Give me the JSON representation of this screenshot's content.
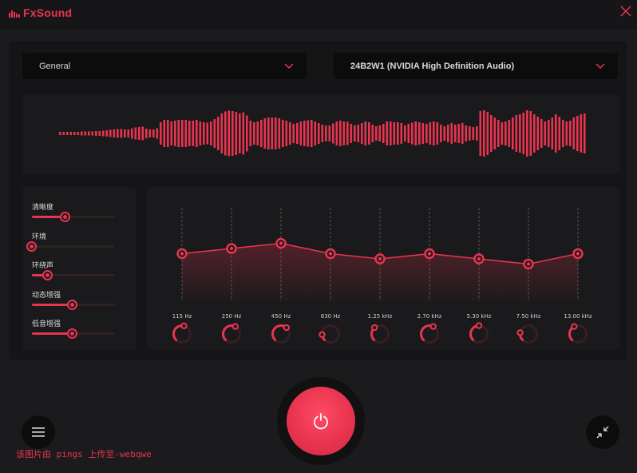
{
  "app": {
    "title": "FxSound"
  },
  "colors": {
    "accent": "#e8344f",
    "background": "#1b1b1d",
    "panel": "#151517",
    "card": "#1a1a1c"
  },
  "presets": {
    "selected": "General"
  },
  "output_device": {
    "selected": "24B2W1 (NVIDIA High Definition Audio)"
  },
  "effects": [
    {
      "label": "清晰度",
      "value": 0.4
    },
    {
      "label": "环境",
      "value": 0.0
    },
    {
      "label": "环绕声",
      "value": 0.19
    },
    {
      "label": "动态增强",
      "value": 0.49
    },
    {
      "label": "低音增强",
      "value": 0.49
    }
  ],
  "equalizer": {
    "bands": [
      {
        "freq": "115 Hz",
        "gain": 0.45,
        "dial": 0.55
      },
      {
        "freq": "250 Hz",
        "gain": 0.5,
        "dial": 0.6
      },
      {
        "freq": "450 Hz",
        "gain": 0.55,
        "dial": 0.65
      },
      {
        "freq": "630 Hz",
        "gain": 0.45,
        "dial": 0.15
      },
      {
        "freq": "1.25 kHz",
        "gain": 0.4,
        "dial": 0.35
      },
      {
        "freq": "2.70 kHz",
        "gain": 0.45,
        "dial": 0.6
      },
      {
        "freq": "5.30 kHz",
        "gain": 0.4,
        "dial": 0.5
      },
      {
        "freq": "7.50 kHz",
        "gain": 0.35,
        "dial": 0.2
      },
      {
        "freq": "13.00 kHz",
        "gain": 0.45,
        "dial": 0.4
      }
    ]
  },
  "visualizer": {
    "levels": [
      0.04,
      0.04,
      0.04,
      0.04,
      0.04,
      0.04,
      0.05,
      0.05,
      0.05,
      0.05,
      0.06,
      0.06,
      0.07,
      0.08,
      0.09,
      0.1,
      0.11,
      0.11,
      0.1,
      0.1,
      0.13,
      0.15,
      0.16,
      0.17,
      0.12,
      0.1,
      0.1,
      0.13,
      0.28,
      0.34,
      0.34,
      0.3,
      0.32,
      0.34,
      0.34,
      0.34,
      0.32,
      0.32,
      0.34,
      0.3,
      0.28,
      0.27,
      0.3,
      0.36,
      0.42,
      0.5,
      0.55,
      0.57,
      0.56,
      0.54,
      0.5,
      0.53,
      0.45,
      0.32,
      0.28,
      0.3,
      0.34,
      0.38,
      0.4,
      0.4,
      0.4,
      0.38,
      0.34,
      0.32,
      0.28,
      0.24,
      0.26,
      0.3,
      0.32,
      0.33,
      0.34,
      0.3,
      0.26,
      0.22,
      0.2,
      0.2,
      0.25,
      0.3,
      0.32,
      0.3,
      0.29,
      0.24,
      0.2,
      0.22,
      0.26,
      0.3,
      0.28,
      0.22,
      0.18,
      0.2,
      0.24,
      0.3,
      0.3,
      0.28,
      0.28,
      0.26,
      0.2,
      0.24,
      0.27,
      0.3,
      0.28,
      0.26,
      0.24,
      0.28,
      0.3,
      0.28,
      0.22,
      0.18,
      0.22,
      0.26,
      0.22,
      0.24,
      0.26,
      0.2,
      0.18,
      0.16,
      0.18,
      0.56,
      0.58,
      0.54,
      0.46,
      0.4,
      0.34,
      0.28,
      0.3,
      0.34,
      0.4,
      0.46,
      0.48,
      0.52,
      0.58,
      0.56,
      0.48,
      0.42,
      0.36,
      0.3,
      0.34,
      0.4,
      0.48,
      0.42,
      0.34,
      0.3,
      0.32,
      0.4,
      0.44,
      0.48,
      0.5
    ]
  },
  "watermark": "该图片由 pings 上传至-webqwe"
}
